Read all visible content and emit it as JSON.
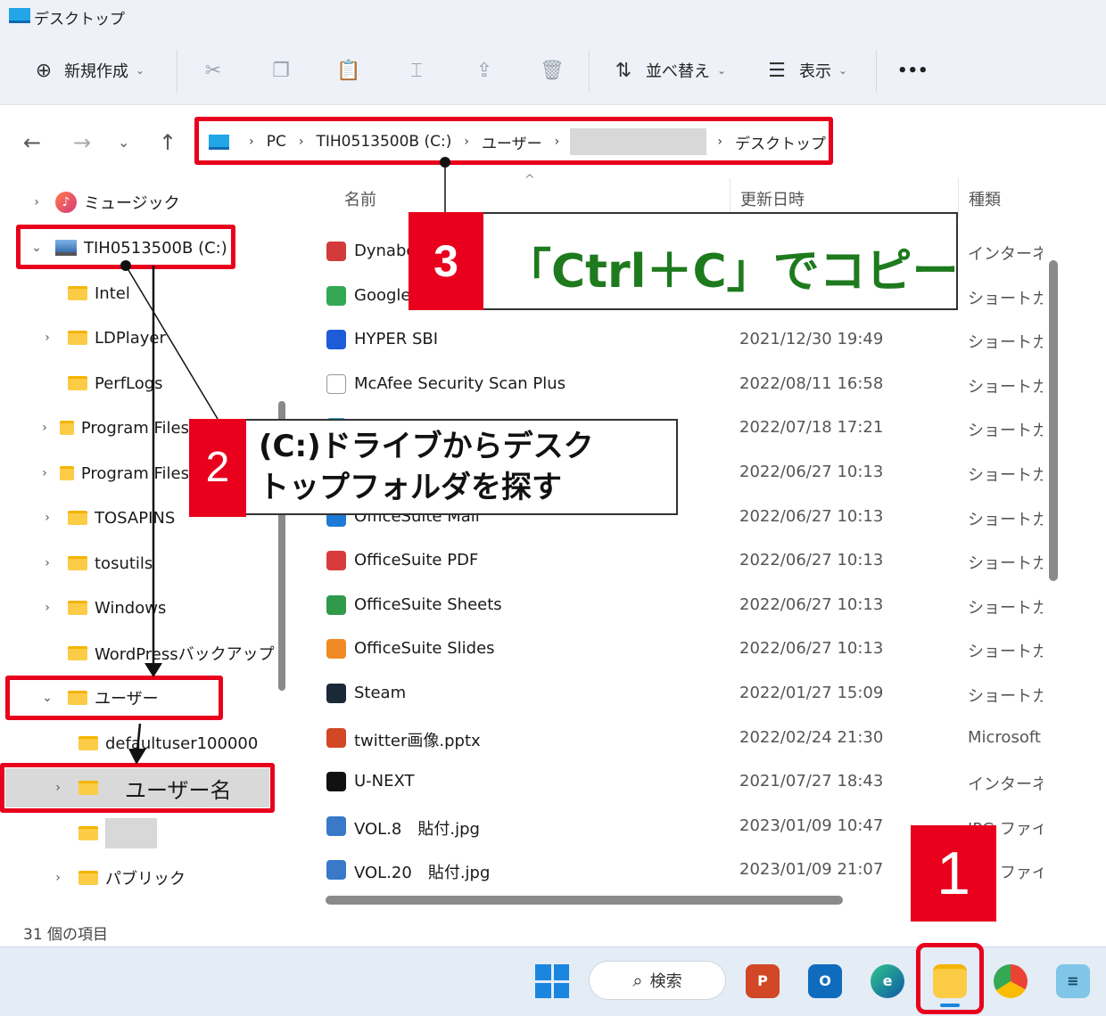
{
  "window": {
    "title": "デスクトップ"
  },
  "toolbar": {
    "new_label": "新規作成",
    "sort_label": "並べ替え",
    "view_label": "表示",
    "more_label": "•••"
  },
  "address": {
    "crumbs": [
      "PC",
      "TIH0513500B (C:)",
      "ユーザー",
      "デスクトップ"
    ]
  },
  "nav": {
    "items": [
      {
        "label": "ミュージック",
        "exp": "›"
      },
      {
        "label": "TIH0513500B (C:)",
        "exp": "⌄"
      },
      {
        "label": "Intel",
        "exp": ""
      },
      {
        "label": "LDPlayer",
        "exp": "›"
      },
      {
        "label": "PerfLogs",
        "exp": ""
      },
      {
        "label": "Program Files",
        "exp": "›"
      },
      {
        "label": "Program Files",
        "exp": "›"
      },
      {
        "label": "TOSAPINS",
        "exp": "›"
      },
      {
        "label": "tosutils",
        "exp": "›"
      },
      {
        "label": "Windows",
        "exp": "›"
      },
      {
        "label": "WordPressバックアップ",
        "exp": ""
      },
      {
        "label": "ユーザー",
        "exp": "⌄"
      },
      {
        "label": "defaultuser100000",
        "exp": ""
      },
      {
        "label": "ユーザー名",
        "exp": "›"
      },
      {
        "label": "",
        "exp": ""
      },
      {
        "label": "パブリック",
        "exp": "›"
      }
    ]
  },
  "list": {
    "headers": {
      "name": "名前",
      "date": "更新日時",
      "type": "種類"
    },
    "rows": [
      {
        "name": "Dynabook",
        "date": "",
        "type": "インターネット",
        "color": "#d33b3b"
      },
      {
        "name": "Google Chrome",
        "date": "",
        "type": "ショートカット",
        "color": "#34a853"
      },
      {
        "name": "HYPER SBI",
        "date": "2021/12/30 19:49",
        "type": "ショートカット",
        "color": "#1e5bd6"
      },
      {
        "name": "McAfee Security Scan Plus",
        "date": "2022/08/11 16:58",
        "type": "ショートカット",
        "color": "#ffffff"
      },
      {
        "name": "",
        "date": "2022/07/18 17:21",
        "type": "ショートカット",
        "color": "#3aa0d8"
      },
      {
        "name": "",
        "date": "2022/06/27 10:13",
        "type": "ショートカット",
        "color": "#3aa0d8"
      },
      {
        "name": "OfficeSuite Mail",
        "date": "2022/06/27 10:13",
        "type": "ショートカット",
        "color": "#1e7ad6"
      },
      {
        "name": "OfficeSuite PDF",
        "date": "2022/06/27 10:13",
        "type": "ショートカット",
        "color": "#d83b3b"
      },
      {
        "name": "OfficeSuite Sheets",
        "date": "2022/06/27 10:13",
        "type": "ショートカット",
        "color": "#2e9a4a"
      },
      {
        "name": "OfficeSuite Slides",
        "date": "2022/06/27 10:13",
        "type": "ショートカット",
        "color": "#f08a24"
      },
      {
        "name": "Steam",
        "date": "2022/01/27 15:09",
        "type": "ショートカット",
        "color": "#1b2838"
      },
      {
        "name": "twitter画像.pptx",
        "date": "2022/02/24 21:30",
        "type": "Microsoft",
        "color": "#d24726"
      },
      {
        "name": "U-NEXT",
        "date": "2021/07/27 18:43",
        "type": "インターネット",
        "color": "#111111"
      },
      {
        "name": "VOL.8　貼付.jpg",
        "date": "2023/01/09 10:47",
        "type": "JPG ファイル",
        "color": "#3a78c8"
      },
      {
        "name": "VOL.20　貼付.jpg",
        "date": "2023/01/09 21:07",
        "type": "JPG ファイル",
        "color": "#3a78c8"
      }
    ]
  },
  "status": {
    "count": "31 個の項目"
  },
  "taskbar": {
    "search_label": "検索"
  },
  "callouts": {
    "step1": "1",
    "step2": "2",
    "step2_line1": "(C:)ドライブからデスク",
    "step2_line2": "トップフォルダを探す",
    "step3": "3",
    "step3_text": "「Ctrl＋C」でコピー"
  },
  "colors": {
    "accent_red": "#e8001c",
    "callout_green": "#1d7a1d",
    "folder": "#fccc47"
  }
}
